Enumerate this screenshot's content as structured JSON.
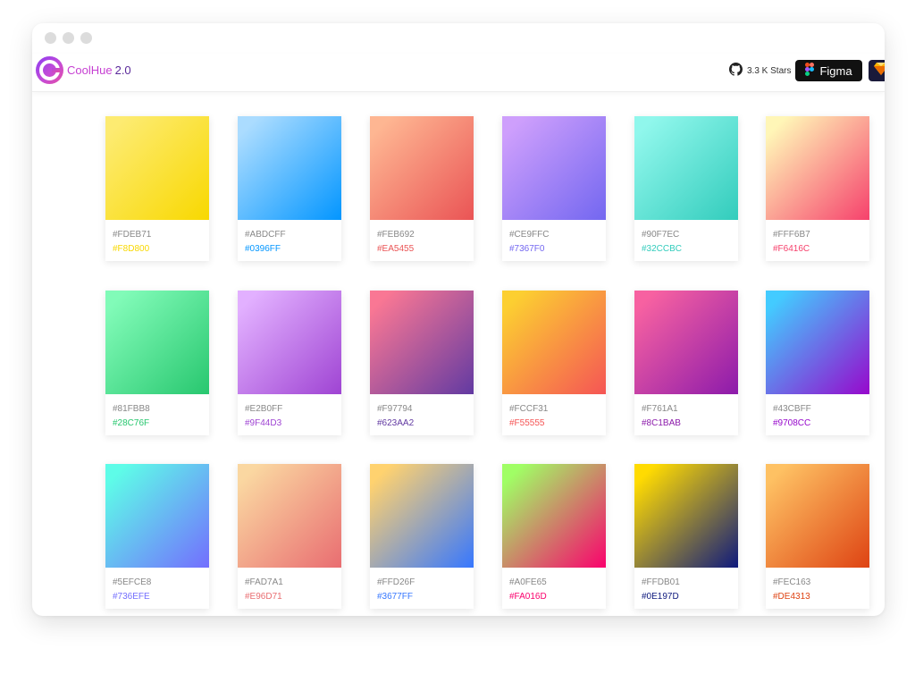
{
  "app": {
    "name": "CoolHue",
    "version": "2.0",
    "stars_label": "3.3 K Stars",
    "figma_label": "Figma"
  },
  "icons": {
    "logo": "coolhue-logo-icon",
    "github": "github-icon",
    "figma": "figma-icon",
    "sketch": "sketch-icon"
  },
  "gradients": [
    {
      "from": "#FDEB71",
      "to": "#F8D800"
    },
    {
      "from": "#ABDCFF",
      "to": "#0396FF"
    },
    {
      "from": "#FEB692",
      "to": "#EA5455"
    },
    {
      "from": "#CE9FFC",
      "to": "#7367F0"
    },
    {
      "from": "#90F7EC",
      "to": "#32CCBC"
    },
    {
      "from": "#FFF6B7",
      "to": "#F6416C"
    },
    {
      "from": "#81FBB8",
      "to": "#28C76F"
    },
    {
      "from": "#E2B0FF",
      "to": "#9F44D3"
    },
    {
      "from": "#F97794",
      "to": "#623AA2"
    },
    {
      "from": "#FCCF31",
      "to": "#F55555"
    },
    {
      "from": "#F761A1",
      "to": "#8C1BAB"
    },
    {
      "from": "#43CBFF",
      "to": "#9708CC"
    },
    {
      "from": "#5EFCE8",
      "to": "#736EFE"
    },
    {
      "from": "#FAD7A1",
      "to": "#E96D71"
    },
    {
      "from": "#FFD26F",
      "to": "#3677FF"
    },
    {
      "from": "#A0FE65",
      "to": "#FA016D"
    },
    {
      "from": "#FFDB01",
      "to": "#0E197D"
    },
    {
      "from": "#FEC163",
      "to": "#DE4313"
    }
  ]
}
